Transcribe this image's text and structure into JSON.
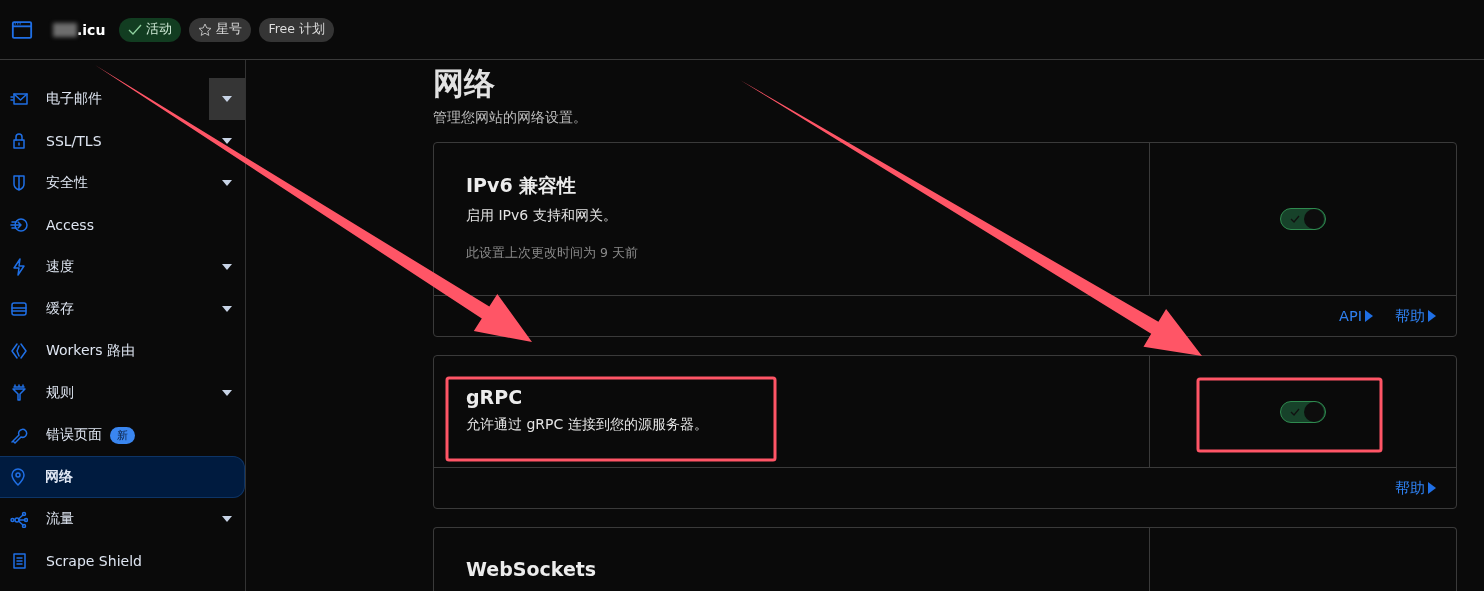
{
  "header": {
    "domain": ".icu",
    "domain_redacted": true,
    "badges": [
      {
        "kind": "status",
        "label": "活动"
      },
      {
        "kind": "star",
        "label": "星号"
      },
      {
        "kind": "plan",
        "label": "Free 计划"
      }
    ]
  },
  "sidebar": {
    "items": [
      {
        "label": "电子邮件",
        "expandable": true,
        "hovered": true,
        "selected": false
      },
      {
        "label": "SSL/TLS",
        "expandable": true,
        "selected": false
      },
      {
        "label": "安全性",
        "expandable": true,
        "selected": false
      },
      {
        "label": "Access",
        "expandable": false,
        "selected": false
      },
      {
        "label": "速度",
        "expandable": true,
        "selected": false
      },
      {
        "label": "缓存",
        "expandable": true,
        "selected": false
      },
      {
        "label": "Workers 路由",
        "expandable": false,
        "selected": false
      },
      {
        "label": "规则",
        "expandable": true,
        "selected": false
      },
      {
        "label": "错误页面",
        "badge": "新",
        "expandable": false,
        "selected": false
      },
      {
        "label": "网络",
        "expandable": false,
        "selected": true
      },
      {
        "label": "流量",
        "expandable": true,
        "selected": false
      },
      {
        "label": "Scrape Shield",
        "expandable": false,
        "selected": false
      }
    ]
  },
  "page": {
    "title": "网络",
    "subtitle": "管理您网站的网络设置。"
  },
  "cards": [
    {
      "title": "IPv6 兼容性",
      "description": "启用 IPv6 支持和网关。",
      "note": "此设置上次更改时间为 9 天前",
      "toggle": {
        "on": true
      },
      "links": [
        "API",
        "帮助"
      ]
    },
    {
      "title": "gRPC",
      "description": "允许通过 gRPC 连接到您的源服务器。",
      "toggle": {
        "on": true
      },
      "links": [
        "帮助"
      ]
    },
    {
      "title": "WebSockets"
    }
  ],
  "annotations": [
    {
      "kind": "arrow"
    },
    {
      "kind": "arrow"
    },
    {
      "kind": "box"
    },
    {
      "kind": "box"
    }
  ]
}
